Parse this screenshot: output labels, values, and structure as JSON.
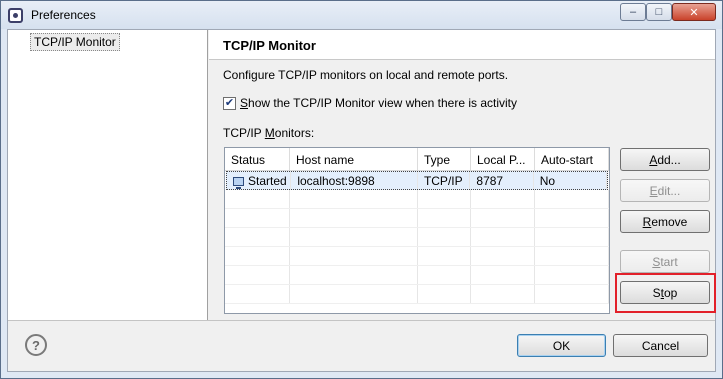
{
  "window": {
    "title": "Preferences",
    "buttons": {
      "minimize": "–",
      "maximize": "□",
      "close": "✕"
    }
  },
  "sidebar": {
    "items": [
      {
        "label": "TCP/IP Monitor",
        "selected": true
      }
    ]
  },
  "page": {
    "title": "TCP/IP Monitor",
    "description": "Configure TCP/IP monitors on local and remote ports.",
    "show_view_checkbox": {
      "checked": true,
      "label_pre": "",
      "mnemonic": "S",
      "label_post": "how the TCP/IP Monitor view when there is activity"
    },
    "monitors_label_pre": "TCP/IP ",
    "monitors_label_mnemonic": "M",
    "monitors_label_post": "onitors:"
  },
  "table": {
    "columns": [
      "Status",
      "Host name",
      "Type",
      "Local P...",
      "Auto-start"
    ],
    "rows": [
      {
        "status": "Started",
        "status_icon": "monitor-icon",
        "host": "localhost:9898",
        "type": "TCP/IP",
        "local_port": "8787",
        "auto_start": "No"
      }
    ]
  },
  "side_buttons": {
    "add": {
      "mnemonic": "A",
      "rest": "dd...",
      "enabled": true
    },
    "edit": {
      "mnemonic": "E",
      "rest": "dit...",
      "enabled": false
    },
    "remove": {
      "mnemonic": "R",
      "rest": "emove",
      "enabled": true
    },
    "start": {
      "mnemonic": "S",
      "rest": "tart",
      "enabled": false
    },
    "stop": {
      "pre": "S",
      "mnemonic": "t",
      "rest": "op",
      "enabled": true,
      "highlighted": true
    }
  },
  "footer": {
    "help_icon": "help-icon",
    "help_glyph": "?",
    "ok_label": "OK",
    "cancel_label": "Cancel"
  },
  "colors": {
    "highlight_border": "#e2202a",
    "selection_bg": "#e4effc",
    "default_button_border": "#3c7fb1"
  }
}
